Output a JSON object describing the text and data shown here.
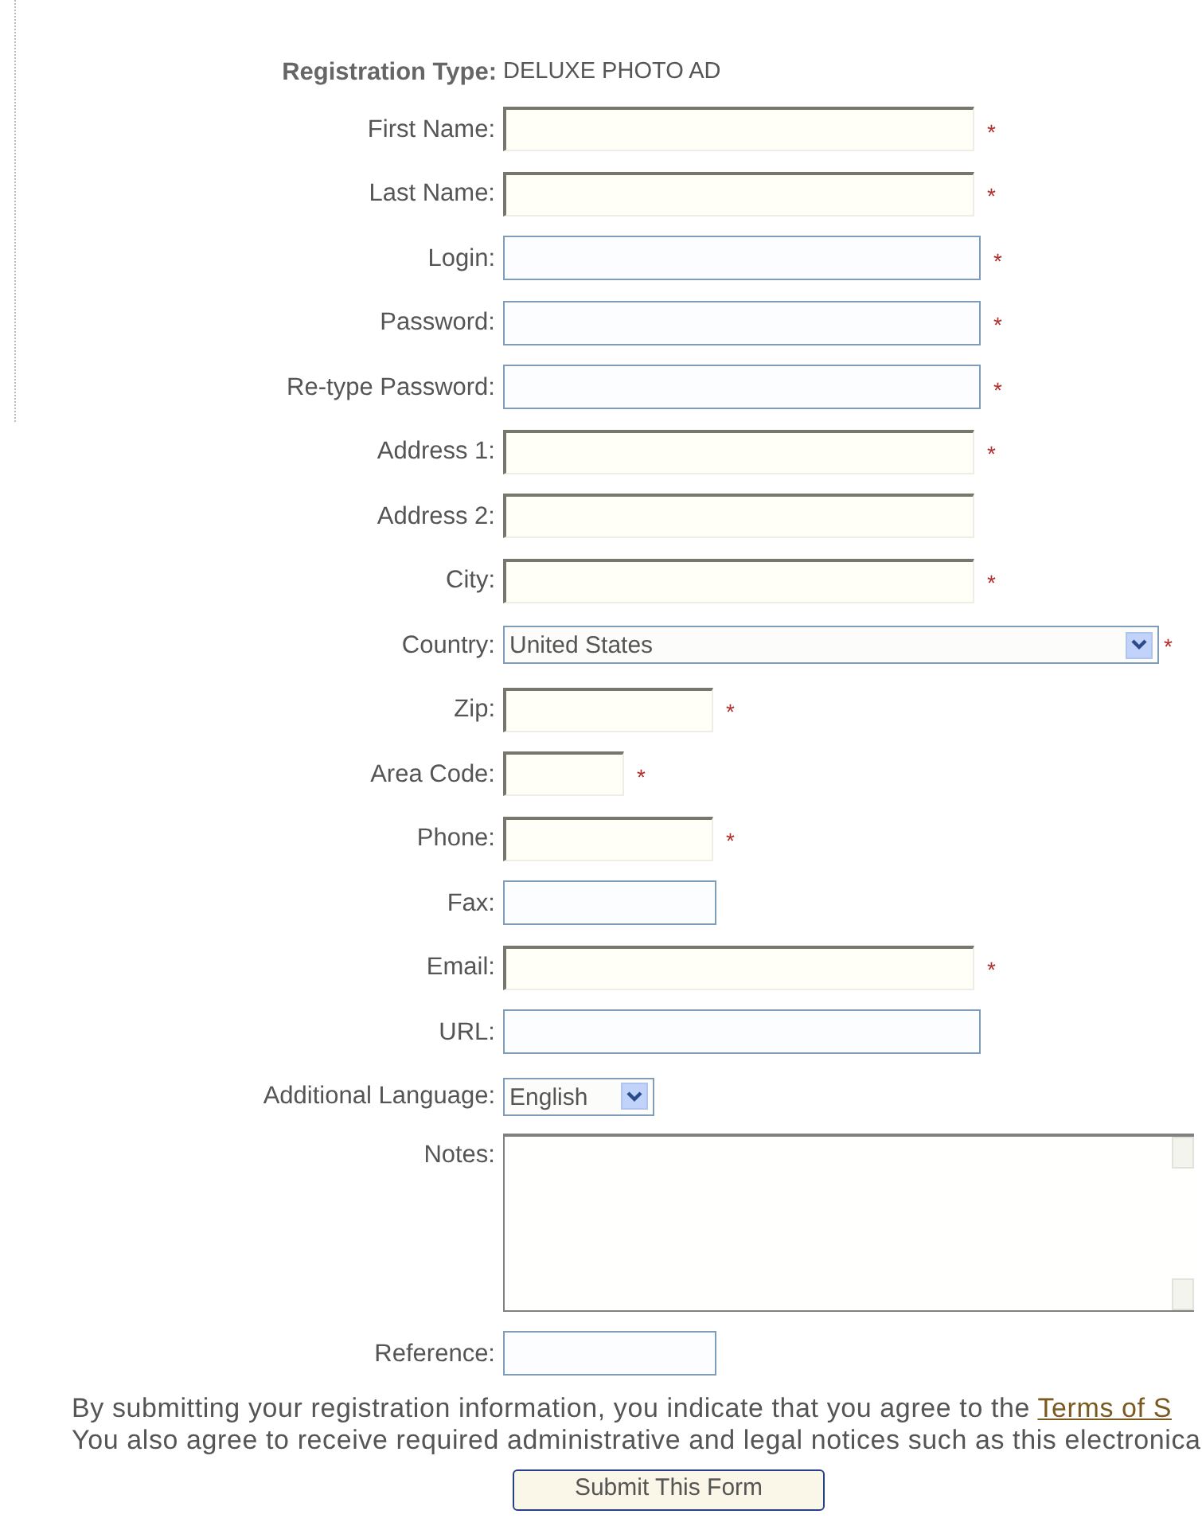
{
  "registration_type": {
    "label": "Registration Type:",
    "value": "DELUXE PHOTO AD"
  },
  "fields": [
    {
      "label": "First Name:",
      "kind": "text",
      "highlighted": true,
      "marker": "*"
    },
    {
      "label": "Last Name:",
      "kind": "text",
      "highlighted": true,
      "marker": "*"
    },
    {
      "label": "Login:",
      "kind": "text",
      "highlighted": false,
      "marker": "*"
    },
    {
      "label": "Password:",
      "kind": "text",
      "highlighted": false,
      "marker": "*"
    },
    {
      "label": "Re-type Password:",
      "kind": "text",
      "highlighted": false,
      "marker": "*"
    },
    {
      "label": "Address 1:",
      "kind": "text",
      "highlighted": true,
      "marker": "*"
    },
    {
      "label": "Address 2:",
      "kind": "text",
      "highlighted": true
    },
    {
      "label": "City:",
      "kind": "text",
      "highlighted": true,
      "marker": "*"
    },
    {
      "label": "Country:",
      "kind": "select",
      "value": "United States",
      "marker": "*"
    },
    {
      "label": "Zip:",
      "kind": "text",
      "highlighted": true,
      "marker": "*"
    },
    {
      "label": "Area Code:",
      "kind": "text",
      "highlighted": true,
      "marker": "*"
    },
    {
      "label": "Phone:",
      "kind": "text",
      "highlighted": true,
      "marker": "*"
    },
    {
      "label": "Fax:",
      "kind": "text",
      "highlighted": false
    },
    {
      "label": "Email:",
      "kind": "text",
      "highlighted": true,
      "marker": "*"
    },
    {
      "label": "URL:",
      "kind": "text",
      "highlighted": false
    },
    {
      "label": "Additional Language:",
      "kind": "select",
      "value": "English"
    },
    {
      "label": "Notes:",
      "kind": "textarea"
    },
    {
      "label": "Reference:",
      "kind": "text",
      "highlighted": false
    }
  ],
  "agreement": {
    "line_1": "By submitting your registration information, you indicate that you agree to the ",
    "link": "Terms of S",
    "line_2": "You also agree to receive required administrative and legal notices such as this electronica"
  },
  "submit_button": "Submit This Form"
}
